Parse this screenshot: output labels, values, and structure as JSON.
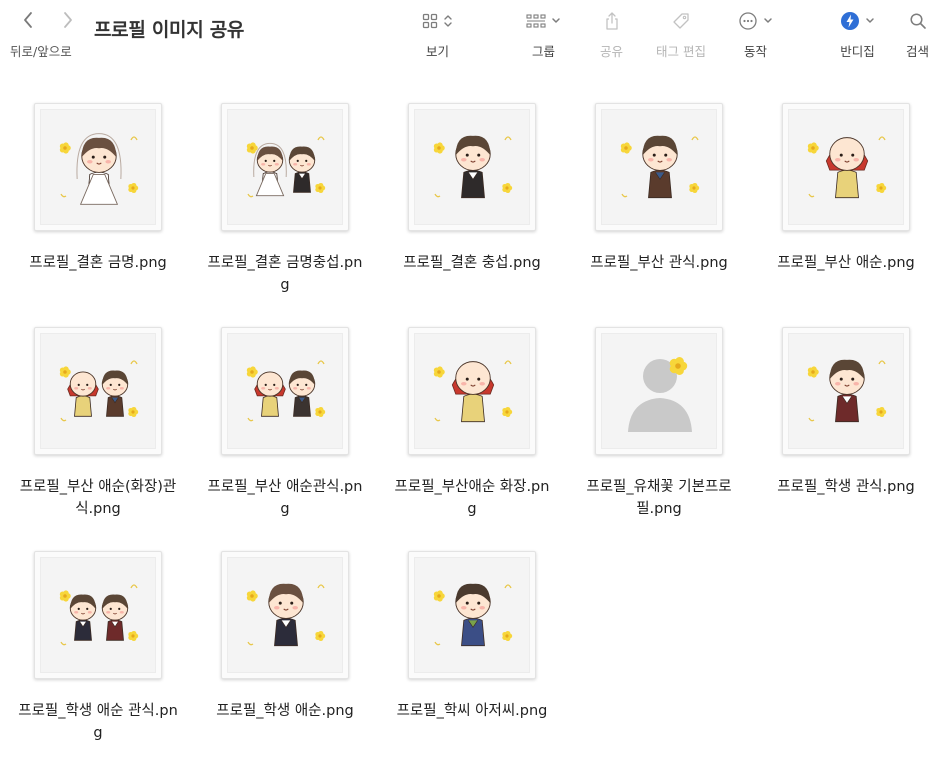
{
  "window": {
    "title": "프로필 이미지 공유"
  },
  "navigation": {
    "label": "뒤로/앞으로",
    "back_icon": "chevron-left-icon",
    "forward_icon": "chevron-right-icon"
  },
  "toolbar": {
    "view_label": "보기",
    "group_label": "그룹",
    "share_label": "공유",
    "tags_label": "태그 편집",
    "action_label": "동작",
    "bandizip_label": "반디집",
    "search_label": "검색"
  },
  "colors": {
    "icon_gray": "#8a8a8a",
    "bandizip_blue": "#2f6fd6",
    "flower_yellow": "#f7d63a"
  },
  "files": [
    {
      "name": "프로필_결혼 금명.png",
      "art": "bride"
    },
    {
      "name": "프로필_결혼 금명충섭.png",
      "art": "wedding-couple"
    },
    {
      "name": "프로필_결혼 충섭.png",
      "art": "groom"
    },
    {
      "name": "프로필_부산 관식.png",
      "art": "busan-boy"
    },
    {
      "name": "프로필_부산 애순.png",
      "art": "busan-girl"
    },
    {
      "name": "프로필_부산 애순(화장)관식.png",
      "art": "busan-couple-makeup"
    },
    {
      "name": "프로필_부산 애순관식.png",
      "art": "busan-couple"
    },
    {
      "name": "프로필_부산애순 화장.png",
      "art": "busan-girl-makeup"
    },
    {
      "name": "프로필_유채꽃 기본프로필.png",
      "art": "default-profile"
    },
    {
      "name": "프로필_학생 관식.png",
      "art": "student-boy"
    },
    {
      "name": "프로필_학생 애순 관식.png",
      "art": "student-couple"
    },
    {
      "name": "프로필_학생 애순.png",
      "art": "student-girl"
    },
    {
      "name": "프로필_학씨 아저씨.png",
      "art": "uncle"
    }
  ]
}
